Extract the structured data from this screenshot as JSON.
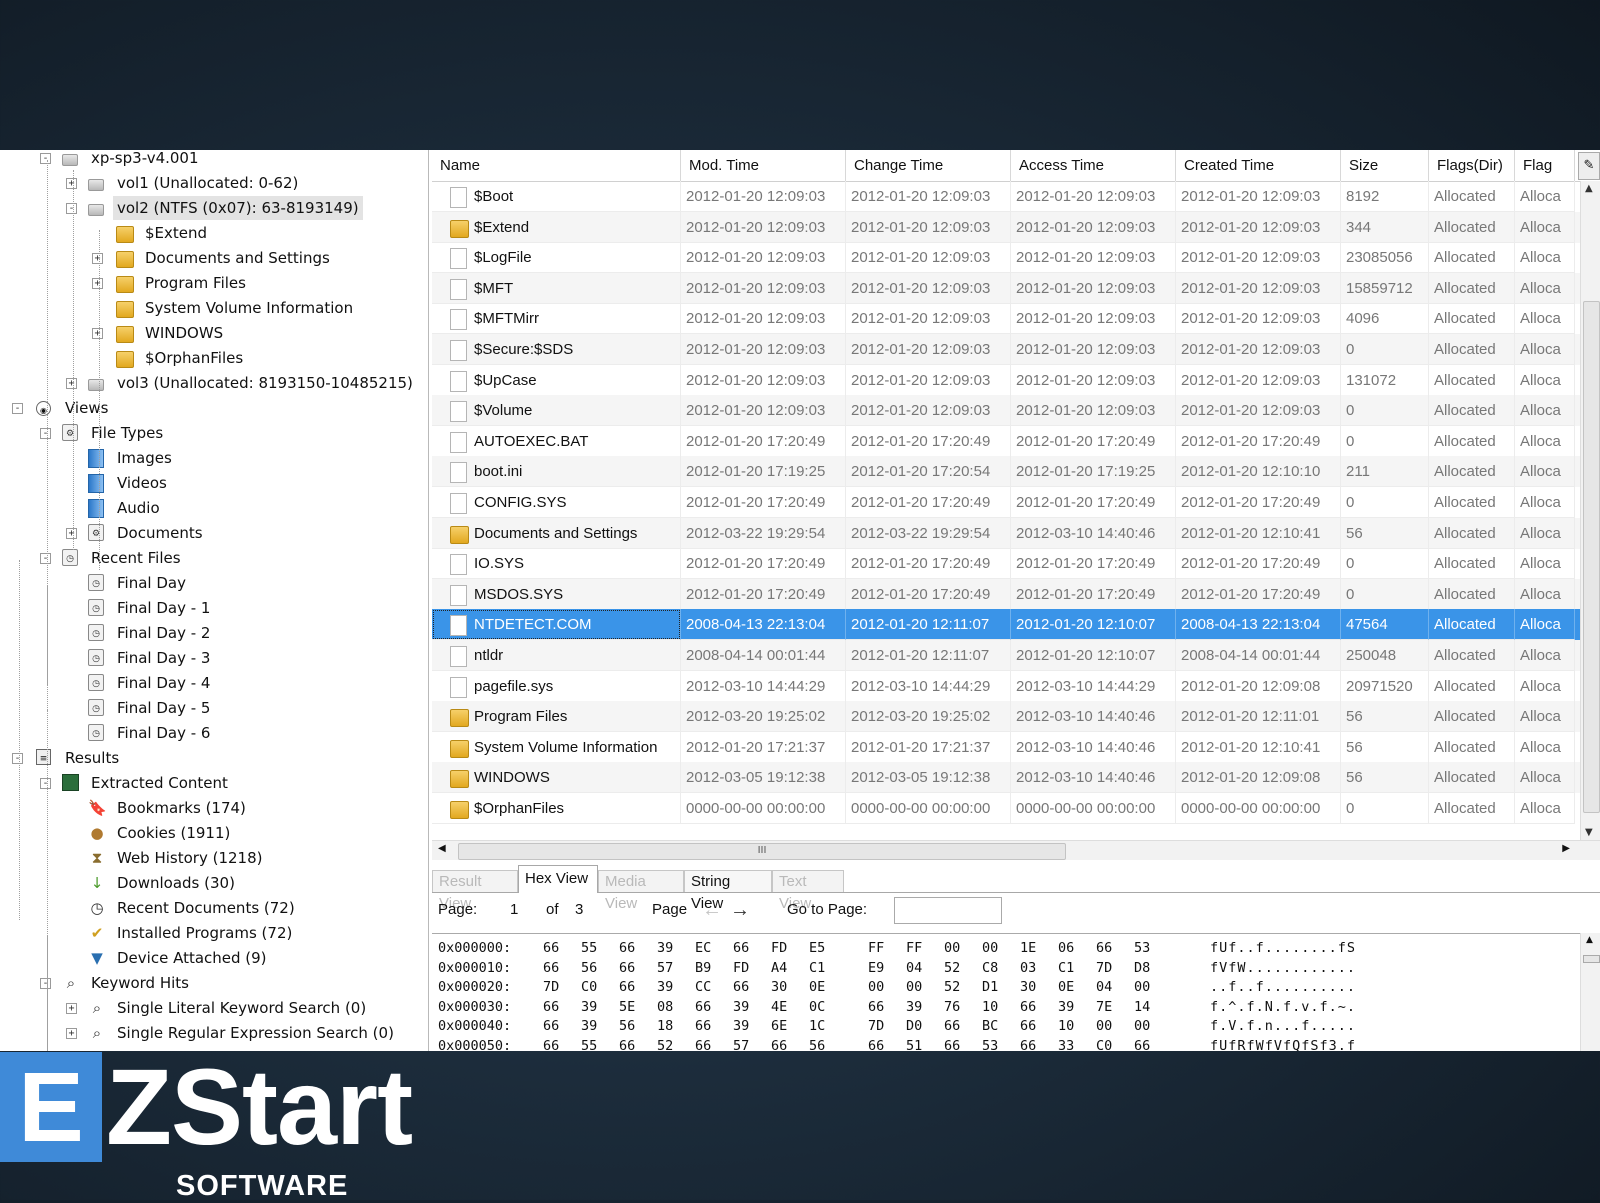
{
  "tree": {
    "root_partial": "xp-sp3-v4.001",
    "vol1": "vol1 (Unallocated: 0-62)",
    "vol2": "vol2 (NTFS (0x07): 63-8193149)",
    "vol2_children": [
      "$Extend",
      "Documents and Settings",
      "Program Files",
      "System Volume Information",
      "WINDOWS",
      "$OrphanFiles"
    ],
    "vol3": "vol3 (Unallocated: 8193150-10485215)",
    "views": "Views",
    "file_types": "File Types",
    "file_type_items": [
      "Images",
      "Videos",
      "Audio",
      "Documents"
    ],
    "recent_files": "Recent Files",
    "recent_items": [
      "Final Day",
      "Final Day - 1",
      "Final Day - 2",
      "Final Day - 3",
      "Final Day - 4",
      "Final Day - 5",
      "Final Day - 6"
    ],
    "results": "Results",
    "extracted_content": "Extracted Content",
    "extracted_items": [
      "Bookmarks (174)",
      "Cookies (1911)",
      "Web History (1218)",
      "Downloads (30)",
      "Recent Documents (72)",
      "Installed Programs (72)",
      "Device Attached (9)"
    ],
    "keyword_hits": "Keyword Hits",
    "keyword_items": [
      "Single Literal Keyword Search (0)",
      "Single Regular Expression Search (0)"
    ]
  },
  "table": {
    "columns": [
      "Name",
      "Mod. Time",
      "Change Time",
      "Access Time",
      "Created Time",
      "Size",
      "Flags(Dir)",
      "Flag"
    ],
    "rows": [
      {
        "name": "$Boot",
        "icon": "file-icon",
        "mod": "2012-01-20 12:09:03",
        "change": "2012-01-20 12:09:03",
        "access": "2012-01-20 12:09:03",
        "created": "2012-01-20 12:09:03",
        "size": "8192",
        "flags": "Allocated",
        "flag2": "Alloca"
      },
      {
        "name": "$Extend",
        "icon": "folder-icon",
        "mod": "2012-01-20 12:09:03",
        "change": "2012-01-20 12:09:03",
        "access": "2012-01-20 12:09:03",
        "created": "2012-01-20 12:09:03",
        "size": "344",
        "flags": "Allocated",
        "flag2": "Alloca"
      },
      {
        "name": "$LogFile",
        "icon": "file-icon",
        "mod": "2012-01-20 12:09:03",
        "change": "2012-01-20 12:09:03",
        "access": "2012-01-20 12:09:03",
        "created": "2012-01-20 12:09:03",
        "size": "23085056",
        "flags": "Allocated",
        "flag2": "Alloca"
      },
      {
        "name": "$MFT",
        "icon": "file-icon",
        "mod": "2012-01-20 12:09:03",
        "change": "2012-01-20 12:09:03",
        "access": "2012-01-20 12:09:03",
        "created": "2012-01-20 12:09:03",
        "size": "15859712",
        "flags": "Allocated",
        "flag2": "Alloca"
      },
      {
        "name": "$MFTMirr",
        "icon": "file-icon",
        "mod": "2012-01-20 12:09:03",
        "change": "2012-01-20 12:09:03",
        "access": "2012-01-20 12:09:03",
        "created": "2012-01-20 12:09:03",
        "size": "4096",
        "flags": "Allocated",
        "flag2": "Alloca"
      },
      {
        "name": "$Secure:$SDS",
        "icon": "file-icon",
        "mod": "2012-01-20 12:09:03",
        "change": "2012-01-20 12:09:03",
        "access": "2012-01-20 12:09:03",
        "created": "2012-01-20 12:09:03",
        "size": "0",
        "flags": "Allocated",
        "flag2": "Alloca"
      },
      {
        "name": "$UpCase",
        "icon": "file-icon",
        "mod": "2012-01-20 12:09:03",
        "change": "2012-01-20 12:09:03",
        "access": "2012-01-20 12:09:03",
        "created": "2012-01-20 12:09:03",
        "size": "131072",
        "flags": "Allocated",
        "flag2": "Alloca"
      },
      {
        "name": "$Volume",
        "icon": "file-icon",
        "mod": "2012-01-20 12:09:03",
        "change": "2012-01-20 12:09:03",
        "access": "2012-01-20 12:09:03",
        "created": "2012-01-20 12:09:03",
        "size": "0",
        "flags": "Allocated",
        "flag2": "Alloca"
      },
      {
        "name": "AUTOEXEC.BAT",
        "icon": "file-icon",
        "mod": "2012-01-20 17:20:49",
        "change": "2012-01-20 17:20:49",
        "access": "2012-01-20 17:20:49",
        "created": "2012-01-20 17:20:49",
        "size": "0",
        "flags": "Allocated",
        "flag2": "Alloca"
      },
      {
        "name": "boot.ini",
        "icon": "file-icon",
        "mod": "2012-01-20 17:19:25",
        "change": "2012-01-20 17:20:54",
        "access": "2012-01-20 17:19:25",
        "created": "2012-01-20 12:10:10",
        "size": "211",
        "flags": "Allocated",
        "flag2": "Alloca"
      },
      {
        "name": "CONFIG.SYS",
        "icon": "file-icon",
        "mod": "2012-01-20 17:20:49",
        "change": "2012-01-20 17:20:49",
        "access": "2012-01-20 17:20:49",
        "created": "2012-01-20 17:20:49",
        "size": "0",
        "flags": "Allocated",
        "flag2": "Alloca"
      },
      {
        "name": "Documents and Settings",
        "icon": "folder-icon",
        "mod": "2012-03-22 19:29:54",
        "change": "2012-03-22 19:29:54",
        "access": "2012-03-10 14:40:46",
        "created": "2012-01-20 12:10:41",
        "size": "56",
        "flags": "Allocated",
        "flag2": "Alloca"
      },
      {
        "name": "IO.SYS",
        "icon": "file-icon",
        "mod": "2012-01-20 17:20:49",
        "change": "2012-01-20 17:20:49",
        "access": "2012-01-20 17:20:49",
        "created": "2012-01-20 17:20:49",
        "size": "0",
        "flags": "Allocated",
        "flag2": "Alloca"
      },
      {
        "name": "MSDOS.SYS",
        "icon": "file-icon",
        "mod": "2012-01-20 17:20:49",
        "change": "2012-01-20 17:20:49",
        "access": "2012-01-20 17:20:49",
        "created": "2012-01-20 17:20:49",
        "size": "0",
        "flags": "Allocated",
        "flag2": "Alloca"
      },
      {
        "name": "NTDETECT.COM",
        "icon": "file-icon",
        "mod": "2008-04-13 22:13:04",
        "change": "2012-01-20 12:11:07",
        "access": "2012-01-20 12:10:07",
        "created": "2008-04-13 22:13:04",
        "size": "47564",
        "flags": "Allocated",
        "flag2": "Alloca",
        "selected": true
      },
      {
        "name": "ntldr",
        "icon": "file-icon",
        "mod": "2008-04-14 00:01:44",
        "change": "2012-01-20 12:11:07",
        "access": "2012-01-20 12:10:07",
        "created": "2008-04-14 00:01:44",
        "size": "250048",
        "flags": "Allocated",
        "flag2": "Alloca"
      },
      {
        "name": "pagefile.sys",
        "icon": "file-icon",
        "mod": "2012-03-10 14:44:29",
        "change": "2012-03-10 14:44:29",
        "access": "2012-03-10 14:44:29",
        "created": "2012-01-20 12:09:08",
        "size": "20971520",
        "flags": "Allocated",
        "flag2": "Alloca"
      },
      {
        "name": "Program Files",
        "icon": "folder-icon",
        "mod": "2012-03-20 19:25:02",
        "change": "2012-03-20 19:25:02",
        "access": "2012-03-10 14:40:46",
        "created": "2012-01-20 12:11:01",
        "size": "56",
        "flags": "Allocated",
        "flag2": "Alloca"
      },
      {
        "name": "System Volume Information",
        "icon": "folder-icon",
        "mod": "2012-01-20 17:21:37",
        "change": "2012-01-20 17:21:37",
        "access": "2012-03-10 14:40:46",
        "created": "2012-01-20 12:10:41",
        "size": "56",
        "flags": "Allocated",
        "flag2": "Alloca"
      },
      {
        "name": "WINDOWS",
        "icon": "folder-icon",
        "mod": "2012-03-05 19:12:38",
        "change": "2012-03-05 19:12:38",
        "access": "2012-03-10 14:40:46",
        "created": "2012-01-20 12:09:08",
        "size": "56",
        "flags": "Allocated",
        "flag2": "Alloca"
      },
      {
        "name": "$OrphanFiles",
        "icon": "folder-icon",
        "mod": "0000-00-00 00:00:00",
        "change": "0000-00-00 00:00:00",
        "access": "0000-00-00 00:00:00",
        "created": "0000-00-00 00:00:00",
        "size": "0",
        "flags": "Allocated",
        "flag2": "Alloca"
      }
    ],
    "hscroll_grip": "III"
  },
  "viewer": {
    "tabs": [
      {
        "label": "Result View",
        "state": "disabled"
      },
      {
        "label": "Hex View",
        "state": "active"
      },
      {
        "label": "Media View",
        "state": "disabled"
      },
      {
        "label": "String View",
        "state": "enabled"
      },
      {
        "label": "Text View",
        "state": "disabled"
      }
    ],
    "page_label": "Page:",
    "page_number": "1",
    "of_label": "of",
    "total_pages": "3",
    "page_nav_label": "Page",
    "goto_label": "Go to Page:",
    "goto_value": "",
    "hex_lines": [
      {
        "offset": "0x000000:",
        "bytes": [
          "66",
          "55",
          "66",
          "39",
          "EC",
          "66",
          "FD",
          "E5",
          "FF",
          "FF",
          "00",
          "00",
          "1E",
          "06",
          "66",
          "53"
        ],
        "ascii": "fUf..f........fS"
      },
      {
        "offset": "0x000010:",
        "bytes": [
          "66",
          "56",
          "66",
          "57",
          "B9",
          "FD",
          "A4",
          "C1",
          "E9",
          "04",
          "52",
          "C8",
          "03",
          "C1",
          "7D",
          "D8"
        ],
        "ascii": "fVfW............"
      },
      {
        "offset": "0x000020:",
        "bytes": [
          "7D",
          "C0",
          "66",
          "39",
          "CC",
          "66",
          "30",
          "0E",
          "00",
          "00",
          "52",
          "D1",
          "30",
          "0E",
          "04",
          "00"
        ],
        "ascii": "..f..f.........."
      },
      {
        "offset": "0x000030:",
        "bytes": [
          "66",
          "39",
          "5E",
          "08",
          "66",
          "39",
          "4E",
          "0C",
          "66",
          "39",
          "76",
          "10",
          "66",
          "39",
          "7E",
          "14"
        ],
        "ascii": "f.^.f.N.f.v.f.~."
      },
      {
        "offset": "0x000040:",
        "bytes": [
          "66",
          "39",
          "56",
          "18",
          "66",
          "39",
          "6E",
          "1C",
          "7D",
          "D0",
          "66",
          "BC",
          "66",
          "10",
          "00",
          "00"
        ],
        "ascii": "f.V.f.n...f....."
      },
      {
        "offset": "0x000050:",
        "bytes": [
          "66",
          "55",
          "66",
          "52",
          "66",
          "57",
          "66",
          "56",
          "66",
          "51",
          "66",
          "53",
          "66",
          "33",
          "C0",
          "66"
        ],
        "ascii": "fUfRfWfVfQfSf3.f"
      }
    ]
  },
  "logo": {
    "letter": "E",
    "word": "ZStart",
    "tagline": "SOFTWARE",
    "accent": "#3f8ad8"
  },
  "colors": {
    "selection": "#3a94e8",
    "background": "#1c2c3b"
  }
}
